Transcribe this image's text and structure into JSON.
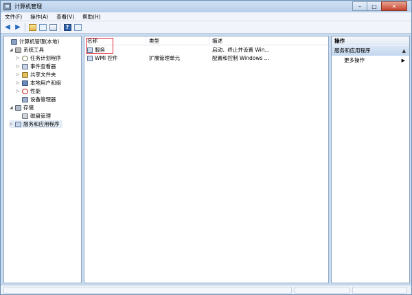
{
  "window": {
    "title": "计算机管理"
  },
  "menu": [
    "文件(F)",
    "操作(A)",
    "查看(V)",
    "帮助(H)"
  ],
  "toolbar": {
    "icons": [
      "back-arrow-icon",
      "forward-arrow-icon",
      "up-folder-icon",
      "show-hide-tree-icon",
      "export-list-icon",
      "help-icon",
      "show-action-pane-icon"
    ]
  },
  "tree": [
    {
      "label": "计算机管理(本地)",
      "icon": "computer-management-icon",
      "expand": ""
    },
    {
      "label": "系统工具",
      "icon": "system-tools-icon",
      "expand": "◢"
    },
    {
      "label": "任务计划程序",
      "icon": "task-scheduler-icon",
      "expand": "▷"
    },
    {
      "label": "事件查看器",
      "icon": "event-viewer-icon",
      "expand": "▷"
    },
    {
      "label": "共享文件夹",
      "icon": "shared-folders-icon",
      "expand": "▷"
    },
    {
      "label": "本地用户和组",
      "icon": "local-users-icon",
      "expand": "▷"
    },
    {
      "label": "性能",
      "icon": "performance-icon",
      "expand": "▷"
    },
    {
      "label": "设备管理器",
      "icon": "device-manager-icon",
      "expand": ""
    },
    {
      "label": "存储",
      "icon": "storage-icon",
      "expand": "◢"
    },
    {
      "label": "磁盘管理",
      "icon": "disk-management-icon",
      "expand": ""
    },
    {
      "label": "服务和应用程序",
      "icon": "services-apps-icon",
      "expand": "▷"
    }
  ],
  "list": {
    "columns": [
      "名称",
      "类型",
      "描述"
    ],
    "rows": [
      {
        "name": "服务",
        "type": "",
        "desc": "启动、终止并设置 Win..."
      },
      {
        "name": "WMI 控件",
        "type": "扩展管理单元",
        "desc": "配置和控制 Windows ..."
      }
    ]
  },
  "actions": {
    "header": "操作",
    "section": "服务和应用程序",
    "more": "更多操作"
  },
  "colors": {
    "highlight": "#e0202a",
    "selection": "#c9dcf0"
  }
}
